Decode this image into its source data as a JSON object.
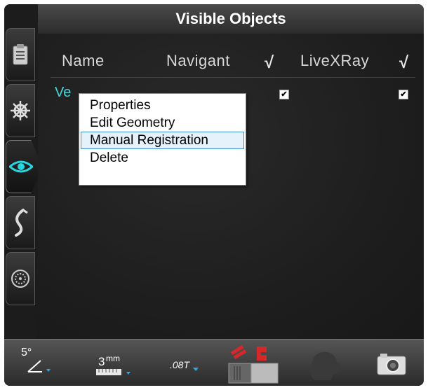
{
  "title": "Visible Objects",
  "columns": {
    "name": "Name",
    "navigant": "Navigant",
    "navigant_check": "√",
    "livexray": "LiveXRay",
    "livexray_check": "√"
  },
  "row": {
    "name": "Ve",
    "navigant_checked": "✔",
    "livexray_checked": "✔"
  },
  "context_menu": {
    "items": [
      {
        "label": "Properties",
        "highlighted": false
      },
      {
        "label": "Edit Geometry",
        "highlighted": false
      },
      {
        "label": "Manual Registration",
        "highlighted": true
      },
      {
        "label": "Delete",
        "highlighted": false
      }
    ]
  },
  "toolbar": {
    "angle_value": "5°",
    "distance_value": "3",
    "distance_unit": "mm",
    "field_value": ".08T"
  },
  "tabs": [
    {
      "icon": "clipboard-icon"
    },
    {
      "icon": "helm-wheel-icon"
    },
    {
      "icon": "eye-icon"
    },
    {
      "icon": "catheter-icon"
    },
    {
      "icon": "target-icon"
    }
  ],
  "colors": {
    "accent": "#49d6d6",
    "highlight_border": "#3c8cd6",
    "magnet_red": "#d62828"
  }
}
